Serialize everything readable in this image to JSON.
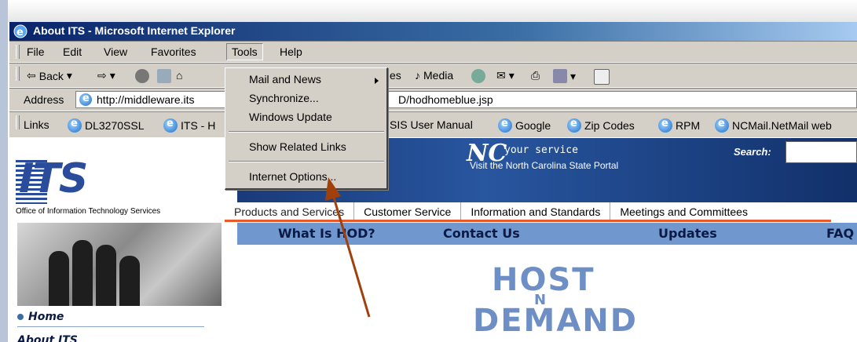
{
  "window": {
    "title": "About ITS - Microsoft Internet Explorer"
  },
  "menu": {
    "items": [
      "File",
      "Edit",
      "View",
      "Favorites",
      "Tools",
      "Help"
    ],
    "open_menu": "Tools"
  },
  "toolbar": {
    "back_label": "Back",
    "search_label": "es",
    "media_label": "Media"
  },
  "address": {
    "label": "Address",
    "url_start": "http://middleware.its",
    "url_end": "D/hodhomeblue.jsp"
  },
  "links": {
    "label": "Links",
    "items": [
      "DL3270SSL",
      "ITS - H",
      "SIS User Manual",
      "Google",
      "Zip Codes",
      "RPM",
      "NCMail.NetMail web"
    ]
  },
  "tools_dropdown": {
    "items": [
      "Mail and News",
      "Synchronize...",
      "Windows Update",
      "Show Related Links",
      "Internet Options..."
    ]
  },
  "page": {
    "logo": "ITS",
    "logo_subtitle": "Office of Information Technology Services",
    "nc_service": "your service",
    "nc_visit": "Visit the North Carolina State Portal",
    "search_label": "Search:",
    "nav_tabs": [
      "Products and Services",
      "Customer Service",
      "Information and Standards",
      "Meetings and Committees"
    ],
    "blue_nav": [
      "What Is HOD?",
      "Contact Us",
      "Updates",
      "FAQ"
    ],
    "sidebar": [
      "Home",
      "About ITS"
    ],
    "hod_line1": "HOST",
    "hod_n": "N",
    "hod_line2": "DEMAND"
  },
  "annotation": {
    "arrow_color": "#a0400a"
  }
}
